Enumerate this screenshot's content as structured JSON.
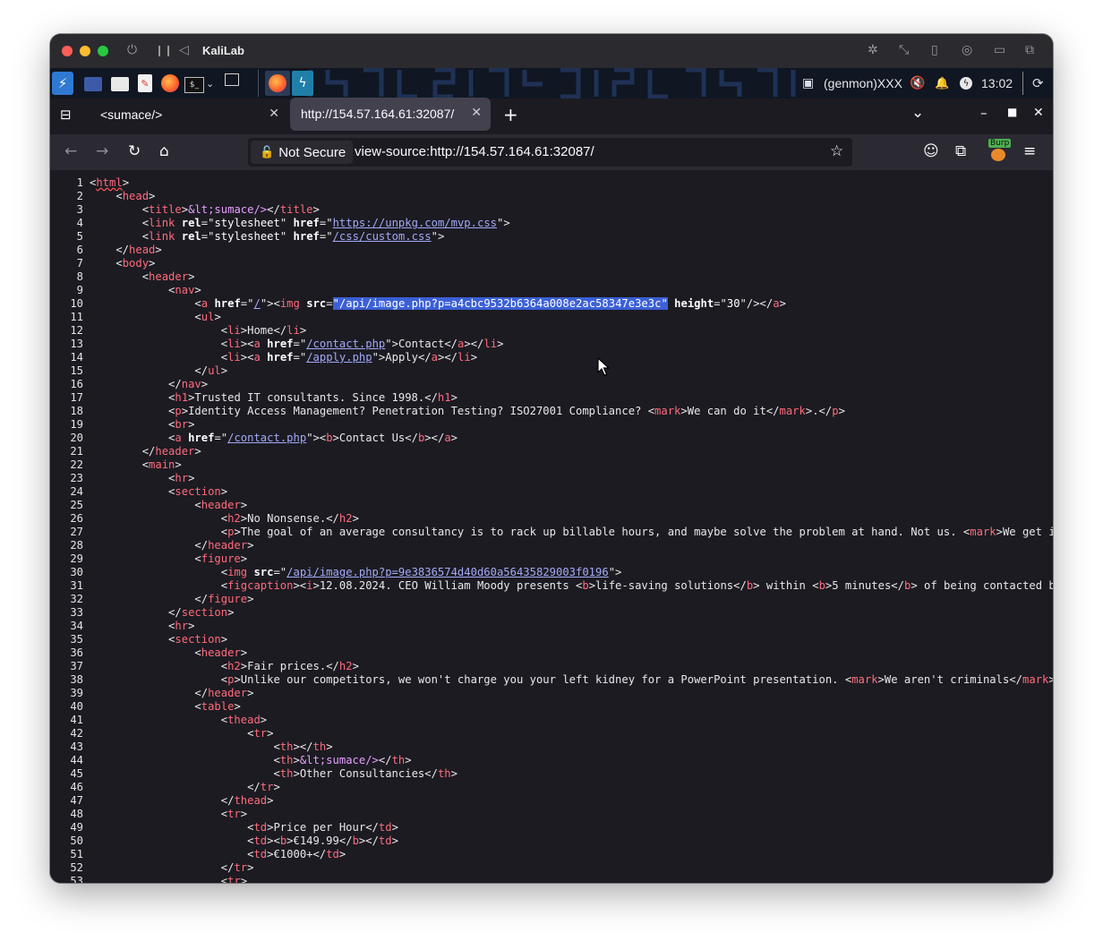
{
  "vm": {
    "title": "KaliLab",
    "controls": [
      "power-icon",
      "pause-icon",
      "back-icon"
    ],
    "right_icons": [
      "brightness-icon",
      "resize-icon",
      "usb-icon",
      "network-icon",
      "folder-icon",
      "window-icon"
    ]
  },
  "panel": {
    "apps": [
      "kali-menu-icon",
      "desktop-icon",
      "file-manager-icon",
      "text-editor-icon",
      "firefox-icon",
      "terminal-icon",
      "dropdown-icon",
      "workspace-icon",
      "firefox-running-icon",
      "burp-icon"
    ],
    "genmon": "(genmon)XXX",
    "time": "13:02"
  },
  "browser": {
    "tabs": [
      {
        "title": "<sumace/>",
        "active": false
      },
      {
        "title": "http://154.57.164.61:32087/",
        "active": true
      }
    ],
    "new_tab": "+",
    "close_glyph": "✕",
    "security_label": "Not Secure",
    "url": "view-source:http://154.57.164.61:32087/",
    "burp_badge": "Burp"
  },
  "source": {
    "line_numbers": [
      "1",
      "2",
      "3",
      "4",
      "5",
      "6",
      "7",
      "8",
      "9",
      "10",
      "11",
      "12",
      "13",
      "14",
      "15",
      "16",
      "17",
      "18",
      "19",
      "20",
      "21",
      "22",
      "23",
      "24",
      "25",
      "26",
      "27",
      "28",
      "29",
      "30",
      "31",
      "32",
      "33",
      "34",
      "35",
      "36",
      "37",
      "38",
      "39",
      "40",
      "41",
      "42",
      "43",
      "44",
      "45",
      "46",
      "47",
      "48",
      "49",
      "50",
      "51",
      "52",
      "53"
    ],
    "l1": {
      "tag": "html"
    },
    "l3": {
      "title": "&lt;sumace/>"
    },
    "l4": {
      "href": "https://unpkg.com/mvp.css"
    },
    "l5": {
      "href": "/css/custom.css"
    },
    "l10": {
      "href": "/",
      "src": "/api/image.php?p=a4cbc9532b6364a008e2ac58347e3e3c",
      "height": "30"
    },
    "l12": {
      "text": "Home"
    },
    "l13": {
      "href": "/contact.php",
      "text": "Contact"
    },
    "l14": {
      "href": "/apply.php",
      "text": "Apply"
    },
    "l17": {
      "text": "Trusted IT consultants. Since 1998."
    },
    "l18": {
      "text": "Identity Access Management? Penetration Testing? ISO27001 Compliance? ",
      "mark": "We can do it",
      "tail": "."
    },
    "l20": {
      "href": "/contact.php",
      "text": "Contact Us"
    },
    "l26": {
      "text": "No Nonsense."
    },
    "l27": {
      "text": "The goal of an average consultancy is to rack up billable hours, and maybe solve the problem at hand. Not us. ",
      "mark": "We get it"
    },
    "l30": {
      "src": "/api/image.php?p=9e3836574d40d60a56435829003f0196"
    },
    "l31": {
      "date": "12.08.2024. CEO William Moody presents ",
      "b1": "life-saving solutions",
      "mid": " within ",
      "b2": "5 minutes",
      "tail": " of being contacted by"
    },
    "l37": {
      "text": "Fair prices."
    },
    "l38": {
      "text": "Unlike our competitors, we won't charge you your left kidney for a PowerPoint presentation. ",
      "mark": "We aren't criminals",
      "tail": ".<"
    },
    "l44": {
      "text": "&lt;sumace/>"
    },
    "l45": {
      "text": "Other Consultancies"
    },
    "l49": {
      "text": "Price per Hour"
    },
    "l50": {
      "text": "€149.99"
    },
    "l51": {
      "text": "€1000+"
    }
  }
}
